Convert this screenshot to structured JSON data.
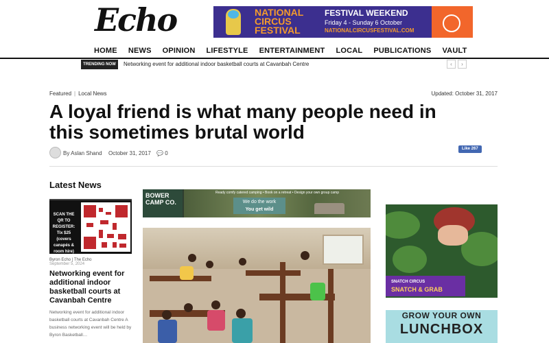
{
  "site": {
    "logo": "Echo"
  },
  "banner_ad": {
    "title": "NATIONAL CIRCUS FESTIVAL",
    "headline": "FESTIVAL WEEKEND",
    "dates": "Friday 4 - Sunday 6 October",
    "url": "NATIONALCIRCUSFESTIVAL.COM",
    "colors": {
      "background": "#3c2f8f",
      "accent": "#f39a2d",
      "badge": "#f2662b"
    }
  },
  "nav": {
    "items": [
      "HOME",
      "NEWS",
      "OPINION",
      "LIFESTYLE",
      "ENTERTAINMENT",
      "LOCAL",
      "PUBLICATIONS",
      "VAULT"
    ]
  },
  "trending": {
    "tag": "TRENDING NOW",
    "headline": "Networking event for additional indoor basketball courts at Cavanbah Centre",
    "prev_icon": "‹",
    "next_icon": "›"
  },
  "article": {
    "categories": [
      "Featured",
      "Local News"
    ],
    "separator": "|",
    "updated": "Updated: October 31, 2017",
    "title": "A loyal friend is what many people need in this sometimes brutal world",
    "author": "By Aslan Shand",
    "date": "October 31, 2017",
    "comments": "0",
    "like_button": "Like 267"
  },
  "latest_news": {
    "heading": "Latest News",
    "qr_text": "SCAN THE QR TO REGISTER: Tix $25 (covers canapés & room hire)",
    "author": "Byron Echo",
    "section": "The Echo",
    "date": "September 5, 2024",
    "title": "Networking event for additional indoor basketball courts at Cavanbah Centre",
    "excerpt": "Networking event for additional indoor basketball courts at Cavanbah Centre A business networking event will be held by Byron Basketball…"
  },
  "camp_ad": {
    "brand": "BOWER CAMP CO.",
    "strip": "Ready comfy catered camping • Book on a retreat • Design your own group camp",
    "line1": "We do the work",
    "line2": "You get wild"
  },
  "snatch_ad": {
    "small": "SNATCH CIRCUS",
    "big": "SNATCH & GRAB"
  },
  "lunchbox_ad": {
    "line1": "GROW YOUR OWN",
    "line2": "LUNCHBOX"
  }
}
